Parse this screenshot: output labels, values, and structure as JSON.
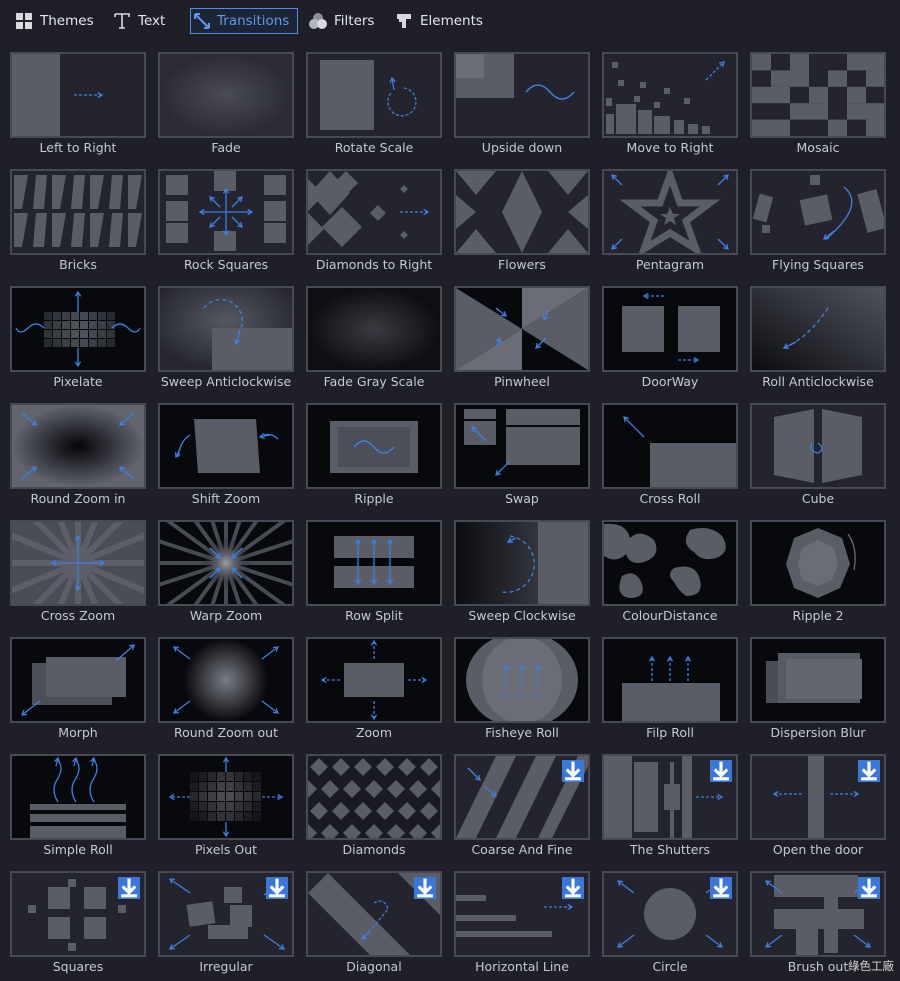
{
  "tabs": [
    {
      "label": "Themes",
      "icon": "grid-icon",
      "active": false
    },
    {
      "label": "Text",
      "icon": "text-icon",
      "active": false
    },
    {
      "label": "Transitions",
      "icon": "transitions-icon",
      "active": true
    },
    {
      "label": "Filters",
      "icon": "filters-icon",
      "active": false
    },
    {
      "label": "Elements",
      "icon": "elements-icon",
      "active": false
    }
  ],
  "colors": {
    "accent": "#4d8ce8",
    "background": "#1e1f27",
    "tile_border": "#474a55",
    "shape": "#5a5c66",
    "arrow": "#3f7fe0"
  },
  "transitions": [
    {
      "label": "Left to Right",
      "pattern": "left-to-right",
      "download": false
    },
    {
      "label": "Fade",
      "pattern": "fade",
      "download": false
    },
    {
      "label": "Rotate Scale",
      "pattern": "rotate-scale",
      "download": false
    },
    {
      "label": "Upside down",
      "pattern": "upside-down",
      "download": false
    },
    {
      "label": "Move to Right",
      "pattern": "move-to-right",
      "download": false
    },
    {
      "label": "Mosaic",
      "pattern": "mosaic",
      "download": false
    },
    {
      "label": "Bricks",
      "pattern": "bricks",
      "download": false
    },
    {
      "label": "Rock Squares",
      "pattern": "rock-squares",
      "download": false
    },
    {
      "label": "Diamonds to Right",
      "pattern": "diamonds-to-right",
      "download": false
    },
    {
      "label": "Flowers",
      "pattern": "flowers",
      "download": false
    },
    {
      "label": "Pentagram",
      "pattern": "pentagram",
      "download": false
    },
    {
      "label": "Flying Squares",
      "pattern": "flying-squares",
      "download": false
    },
    {
      "label": "Pixelate",
      "pattern": "pixelate",
      "download": false
    },
    {
      "label": "Sweep Anticlockwise",
      "pattern": "sweep-anticlockwise",
      "download": false
    },
    {
      "label": "Fade Gray Scale",
      "pattern": "fade-gray-scale",
      "download": false
    },
    {
      "label": "Pinwheel",
      "pattern": "pinwheel",
      "download": false
    },
    {
      "label": "DoorWay",
      "pattern": "doorway",
      "download": false
    },
    {
      "label": "Roll Anticlockwise",
      "pattern": "roll-anticlockwise",
      "download": false
    },
    {
      "label": "Round Zoom in",
      "pattern": "round-zoom-in",
      "download": false
    },
    {
      "label": "Shift Zoom",
      "pattern": "shift-zoom",
      "download": false
    },
    {
      "label": "Ripple",
      "pattern": "ripple",
      "download": false
    },
    {
      "label": "Swap",
      "pattern": "swap",
      "download": false
    },
    {
      "label": "Cross Roll",
      "pattern": "cross-roll",
      "download": false
    },
    {
      "label": "Cube",
      "pattern": "cube",
      "download": false
    },
    {
      "label": "Cross Zoom",
      "pattern": "cross-zoom",
      "download": false
    },
    {
      "label": "Warp Zoom",
      "pattern": "warp-zoom",
      "download": false
    },
    {
      "label": "Row Split",
      "pattern": "row-split",
      "download": false
    },
    {
      "label": "Sweep Clockwise",
      "pattern": "sweep-clockwise",
      "download": false
    },
    {
      "label": "ColourDistance",
      "pattern": "colour-distance",
      "download": false
    },
    {
      "label": "Ripple 2",
      "pattern": "ripple-2",
      "download": false
    },
    {
      "label": "Morph",
      "pattern": "morph",
      "download": false
    },
    {
      "label": "Round Zoom out",
      "pattern": "round-zoom-out",
      "download": false
    },
    {
      "label": "Zoom",
      "pattern": "zoom",
      "download": false
    },
    {
      "label": "Fisheye Roll",
      "pattern": "fisheye-roll",
      "download": false
    },
    {
      "label": "Filp Roll",
      "pattern": "filp-roll",
      "download": false
    },
    {
      "label": "Dispersion Blur",
      "pattern": "dispersion-blur",
      "download": false
    },
    {
      "label": "Simple Roll",
      "pattern": "simple-roll",
      "download": false
    },
    {
      "label": "Pixels Out",
      "pattern": "pixels-out",
      "download": false
    },
    {
      "label": "Diamonds",
      "pattern": "diamonds",
      "download": false
    },
    {
      "label": "Coarse And Fine",
      "pattern": "coarse-and-fine",
      "download": true
    },
    {
      "label": "The Shutters",
      "pattern": "the-shutters",
      "download": true
    },
    {
      "label": "Open the door",
      "pattern": "open-the-door",
      "download": true
    },
    {
      "label": "Squares",
      "pattern": "squares",
      "download": true
    },
    {
      "label": "Irregular",
      "pattern": "irregular",
      "download": true
    },
    {
      "label": "Diagonal",
      "pattern": "diagonal",
      "download": true
    },
    {
      "label": "Horizontal Line",
      "pattern": "horizontal-line",
      "download": true
    },
    {
      "label": "Circle",
      "pattern": "circle",
      "download": true
    },
    {
      "label": "Brush out",
      "pattern": "brush-out",
      "download": true
    }
  ],
  "watermark": "綠色工廠"
}
